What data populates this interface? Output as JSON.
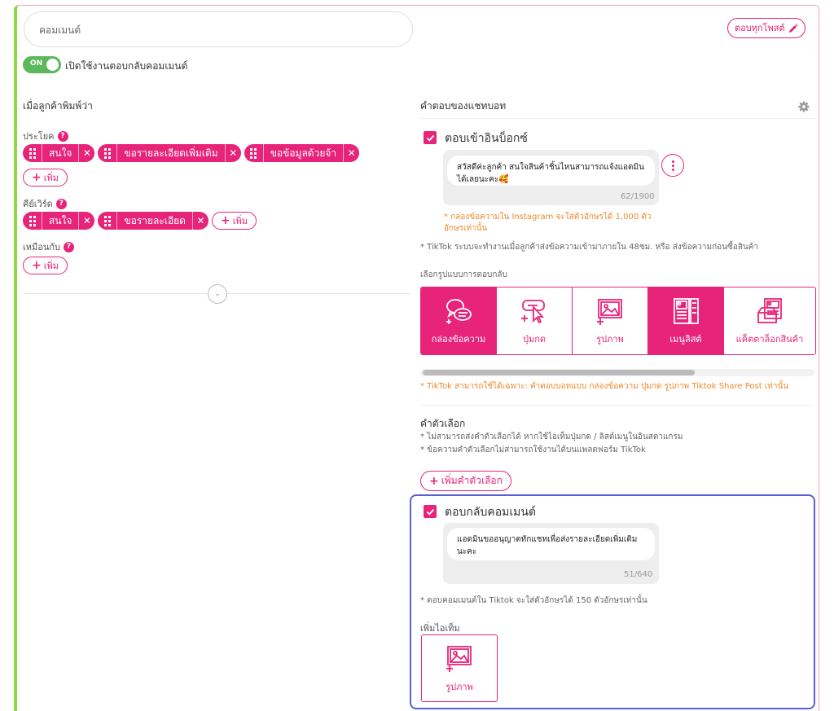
{
  "header": {
    "name_placeholder": "คอมเมนต์",
    "reply_all_label": "ตอบทุกโพสต์"
  },
  "toggle": {
    "state": "ON",
    "label": "เปิดใช้งานตอบกลับคอมเมนต์"
  },
  "left": {
    "title": "เมื่อลูกค้าพิมพ์ว่า",
    "sentence": {
      "label": "ประโยค",
      "chips": [
        "สนใจ",
        "ขอรายละเอียดเพิ่มเติม",
        "ขอข้อมูลด้วยจ้า"
      ],
      "add_label": "เพิ่ม"
    },
    "keyword": {
      "label": "คีย์เวิร์ด",
      "chips": [
        "สนใจ",
        "ขอรายละเอียด"
      ],
      "add_label": "เพิ่ม"
    },
    "same_as": {
      "label": "เหมือนกับ",
      "add_label": "เพิ่ม"
    },
    "help_glyph": "?"
  },
  "right": {
    "title": "คำตอบของแชทบอท",
    "inbox": {
      "label": "ตอบเข้าอินบ็อกซ์",
      "message": "สวัสดีค่ะลูกค้า สนใจสินค้าชิ้นไหนสามารถแจ้งแอดมินได้เลยนะคะ🥰",
      "counter": "62/1900",
      "ig_note": "* กล่องข้อความใน Instagram จะใส่ตัวอักษรได้ 1,000 ตัวอักษรเท่านั้น"
    },
    "tiktok_note": "* TikTok ระบบจะทำงานเมื่อลูกค้าส่งข้อความเข้ามาภายใน 48ชม. หรือ ส่งข้อความก่อนซื้อสินค้า",
    "type_label": "เลือกรูปแบบการตอบกลับ",
    "types": [
      {
        "label": "กล่องข้อความ",
        "icon": "chat-bubbles-icon",
        "active": true
      },
      {
        "label": "ปุ่มกด",
        "icon": "button-click-icon",
        "active": false
      },
      {
        "label": "รูปภาพ",
        "icon": "image-icon",
        "active": false
      },
      {
        "label": "เมนูลิสต์",
        "icon": "menu-list-icon",
        "active": true
      },
      {
        "label": "แค็ตตาล็อกสินค้า",
        "icon": "catalog-icon",
        "active": false
      }
    ],
    "tiktok_types_note": "* TikTok สามารถใช้ได้เฉพาะ: คำตอบบอทแบบ กล่องข้อความ ปุ่มกด รูปภาพ Tiktok Share Post เท่านั้น",
    "quick_reply": {
      "title": "คำตัวเลือก",
      "note1": "* ไม่สามารถส่งคำตัวเลือกได้ หากใช้ไอเท็มปุ่มกด / ลิสต์เมนูในอินสตาแกรม",
      "note2": "* ข้อความคำตัวเลือกไม่สามารถใช้งานได้บนแพลตฟอร์ม TikTok",
      "add_label": "เพิ่มคำตัวเลือก"
    },
    "comment_reply": {
      "label": "ตอบกลับคอมเมนต์",
      "message": "แอดมินขออนุญาตทักแชทเพื่อส่งรายละเอียดเพิ่มเติมนะคะ",
      "counter": "51/640",
      "note": "* ตอบคอมเมนต์ใน Tiktok จะใส่ตัวอักษรได้ 150 ตัวอักษรเท่านั้น",
      "add_item_label": "เพิ่มไอเท็ม",
      "item_label": "รูปภาพ"
    }
  },
  "colors": {
    "accent": "#e8247a",
    "toggle_on": "#5cb85c",
    "left_bar": "#8cd94a",
    "focus_border": "#5a5fd6",
    "warning": "#f0882b"
  }
}
